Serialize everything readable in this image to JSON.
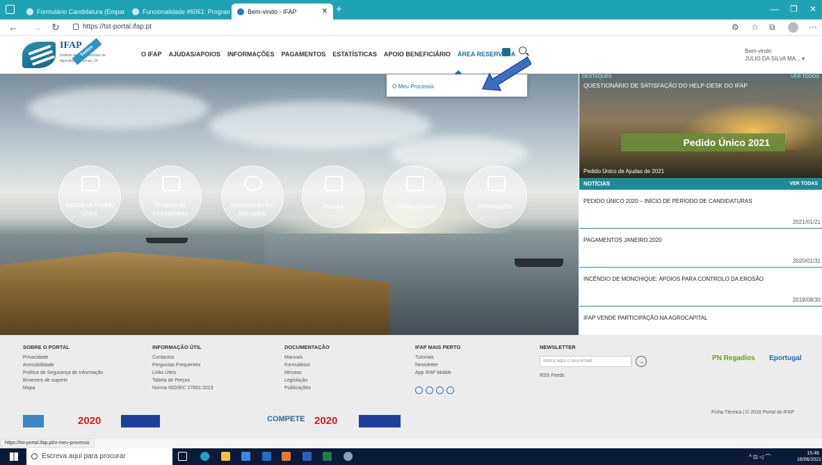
{
  "browser": {
    "tabs": [
      {
        "title": "Formulário Candidatura (Empar"
      },
      {
        "title": "Funcionalidade #6061: Program"
      },
      {
        "title": "Bem-vindo - IFAP"
      }
    ],
    "url": "https://tst-portal.ifap.pt",
    "status_url": "https://tst-portal.ifap.pt/o-meu-processo"
  },
  "header": {
    "logo_name": "IFAP",
    "logo_ribbon": "Testes",
    "logo_sub": "Instituto de Financiamento da Agricultura e Pescas, I.P.",
    "nav": [
      "O IFAP",
      "AJUDAS/APOIOS",
      "INFORMAÇÕES",
      "PAGAMENTOS",
      "ESTATÍSTICAS",
      "APOIO BENEFICIÁRIO",
      "ÁREA RESERVADA"
    ],
    "welcome": "Bem-vindo",
    "user_name": "JULIO DA SILVA MA... ▾"
  },
  "dropdown": {
    "item": "O Meu Processo"
  },
  "hero": {
    "circles": [
      {
        "label": "Ajudas no Pedido Único"
      },
      {
        "label": "Projetos de Investimento"
      },
      {
        "label": "Intervenção em Mercados"
      },
      {
        "label": "Pescas"
      },
      {
        "label": "Outras Ajudas"
      },
      {
        "label": "Informações"
      }
    ]
  },
  "destaques": {
    "header": "DESTAQUES",
    "view_all": "VER TODOS",
    "question": "QUESTIONÁRIO DE SATISFAÇÃO DO HELP-DESK DO IFAP",
    "banner": "Pedido Único 2021",
    "caption": "Pedido Único de Ajudas de 2021"
  },
  "noticias": {
    "header": "NOTÍCIAS",
    "view_all": "VER TODAS",
    "items": [
      {
        "title": "PEDIDO ÚNICO 2020 – INÍCIO DE PERÍODO DE CANDIDATURAS",
        "date": "2021/01/21"
      },
      {
        "title": "PAGAMENTOS JANEIRO 2020",
        "date": "2020/01/31"
      },
      {
        "title": "INCÊNDIO DE MONCHIQUE: APOIOS PARA CONTROLO DA EROSÃO",
        "date": "2018/08/30"
      },
      {
        "title": "IFAP VENDE PARTICIPAÇÃO NA AGROCAPITAL",
        "date": ""
      }
    ]
  },
  "footer": {
    "cols": [
      {
        "title": "SOBRE O PORTAL",
        "links": [
          "Privacidade",
          "Acessibilidade",
          "Política de Segurança de Informação",
          "Browsers de suporte",
          "Mapa"
        ]
      },
      {
        "title": "INFORMAÇÃO ÚTIL",
        "links": [
          "Contactos",
          "Perguntas Frequentes",
          "Links Úteis",
          "Tabela de Preços",
          "Norma ISO/IEC 27001:2013"
        ]
      },
      {
        "title": "DOCUMENTAÇÃO",
        "links": [
          "Manuais",
          "Formulários",
          "Minutas",
          "Legislação",
          "Publicações"
        ]
      },
      {
        "title": "IFAP MAIS PERTO",
        "links": [
          "Tutoriais",
          "Newsletter",
          "App IFAP Mobile"
        ]
      }
    ],
    "newsletter_title": "NEWSLETTER",
    "newsletter_placeholder": "Insira aqui o seu email",
    "rss": "RSS Feeds",
    "partner1": "PN Regadios",
    "partner2": "Eportugal",
    "copyright": "Ficha Técnica  |  © 2016 Portal do IFAP",
    "logo_2020": "2020",
    "logo_compete": "COMPETE"
  },
  "taskbar": {
    "search": "Escreva aqui para procurar",
    "time": "15:46",
    "date": "16/06/2021"
  }
}
